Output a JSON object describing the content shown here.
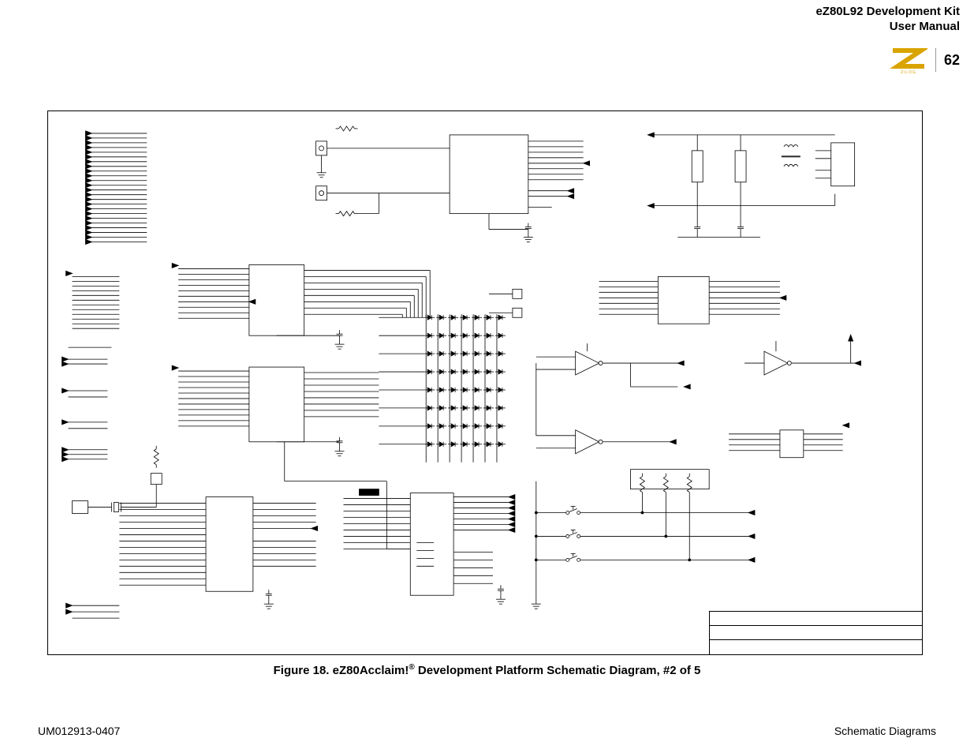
{
  "header": {
    "title_line1": "eZ80L92 Development Kit",
    "title_line2": "User Manual",
    "page_number": "62",
    "logo_text": "ZiLOG"
  },
  "caption": {
    "prefix": "Figure 18. eZ80Acclaim!",
    "reg": "®",
    "suffix": " Development Platform Schematic Diagram, #2 of 5"
  },
  "footer": {
    "left": "UM012913-0407",
    "right": "Schematic Diagrams"
  },
  "title_block": {
    "row1_left": "",
    "row1_right": "",
    "row2_left": "",
    "row2_right": "",
    "row3_left": "",
    "row3_right": ""
  },
  "schematic": {
    "description": "Electronic schematic diagram sheet 2 of 5 for the eZ80Acclaim! development platform. Contains bus connectors with off-page arrows on the left, several rectangular IC packages with pin-buses, a 7x8 grid of diode/LED symbols (matrix) center-right, multiple op-amp/buffer triangle symbols on the right, discrete resistor/capacitor/inductor networks upper-right, a crystal oscillator lower-left, and several pushbutton switches lower-right feeding into off-page arrows. No component designators or net names are legible at this resolution.",
    "ic_blocks": 6,
    "led_matrix_rows": 8,
    "led_matrix_cols": 7,
    "opamps": 3,
    "pushbuttons": 3
  }
}
